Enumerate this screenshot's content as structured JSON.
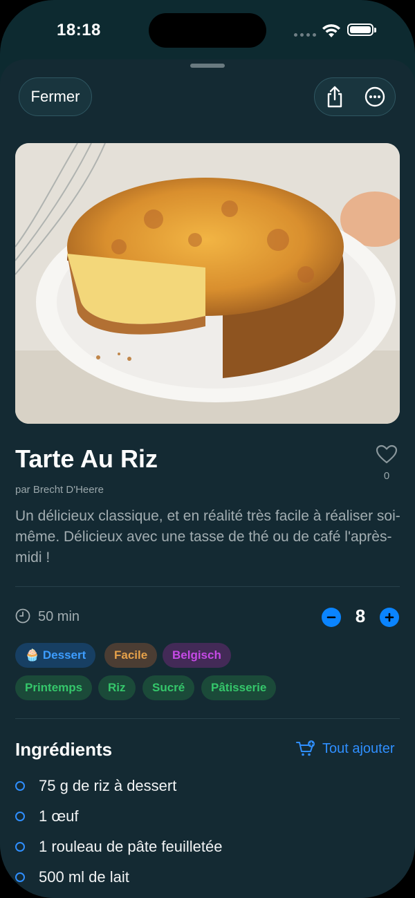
{
  "status_bar": {
    "time": "18:18"
  },
  "toolbar": {
    "close_label": "Fermer",
    "share_icon": "share-icon",
    "more_icon": "ellipsis-circle-icon"
  },
  "recipe": {
    "title": "Tarte Au Riz",
    "author": "par Brecht D'Heere",
    "favorites_count": "0",
    "description": "Un délicieux classique, et en réalité très facile à réaliser soi-même. Délicieux avec une tasse de thé ou de café l'après-midi !",
    "duration": "50 min",
    "servings": "8",
    "tags": [
      {
        "label": "🧁 Dessert",
        "color": "#3d9dff"
      },
      {
        "label": "Facile",
        "color": "#e6a14a"
      },
      {
        "label": "Belgisch",
        "color": "#c64ae6"
      },
      {
        "label": "Printemps",
        "color": "#35c76b"
      },
      {
        "label": "Riz",
        "color": "#35c76b"
      },
      {
        "label": "Sucré",
        "color": "#35c76b"
      },
      {
        "label": "Pâtisserie",
        "color": "#35c76b"
      }
    ]
  },
  "ingredients": {
    "title": "Ingrédients",
    "add_all_label": "Tout ajouter",
    "items": [
      "75 g de riz à dessert",
      "1 œuf",
      "1 rouleau de pâte feuilletée",
      "500 ml de lait"
    ]
  },
  "colors": {
    "accent": "#0a84ff",
    "sheet_bg": "#142a33"
  }
}
